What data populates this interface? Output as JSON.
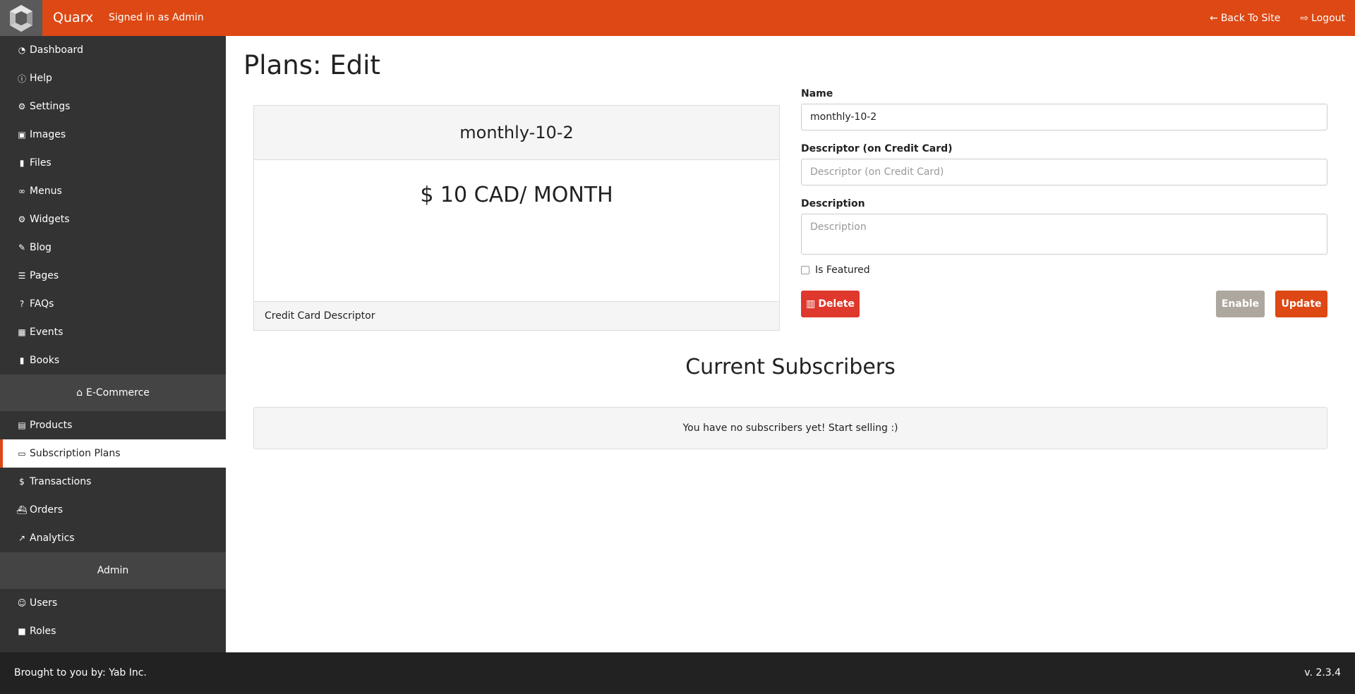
{
  "topbar": {
    "brand": "Quarx",
    "signed_in": "Signed in as Admin",
    "back_to_site": "Back To Site",
    "logout": "Logout",
    "accent_color": "#dd4814"
  },
  "sidebar": {
    "items": [
      {
        "label": "Dashboard",
        "icon": "dashboard-icon"
      },
      {
        "label": "Help",
        "icon": "info-icon"
      },
      {
        "label": "Settings",
        "icon": "gear-icon"
      },
      {
        "label": "Images",
        "icon": "image-icon"
      },
      {
        "label": "Files",
        "icon": "file-icon"
      },
      {
        "label": "Menus",
        "icon": "link-icon"
      },
      {
        "label": "Widgets",
        "icon": "gear-icon"
      },
      {
        "label": "Blog",
        "icon": "pencil-icon"
      },
      {
        "label": "Pages",
        "icon": "page-icon"
      },
      {
        "label": "FAQs",
        "icon": "question-icon"
      },
      {
        "label": "Events",
        "icon": "calendar-icon"
      },
      {
        "label": "Books",
        "icon": "file-icon"
      }
    ],
    "ecommerce_header": "E-Commerce",
    "ecommerce_items": [
      {
        "label": "Products",
        "icon": "box-icon"
      },
      {
        "label": "Subscription Plans",
        "icon": "credit-card-icon",
        "active": true
      },
      {
        "label": "Transactions",
        "icon": "dollar-icon"
      },
      {
        "label": "Orders",
        "icon": "ship-icon"
      },
      {
        "label": "Analytics",
        "icon": "chart-icon"
      }
    ],
    "admin_header": "Admin",
    "admin_items": [
      {
        "label": "Users",
        "icon": "users-icon"
      },
      {
        "label": "Roles",
        "icon": "lock-icon"
      }
    ]
  },
  "main": {
    "title": "Plans: Edit",
    "plan_card": {
      "name": "monthly-10-2",
      "price": "$ 10 CAD/ MONTH",
      "footer": "Credit Card Descriptor"
    },
    "form": {
      "name_label": "Name",
      "name_value": "monthly-10-2",
      "descriptor_label": "Descriptor (on Credit Card)",
      "descriptor_placeholder": "Descriptor (on Credit Card)",
      "description_label": "Description",
      "description_placeholder": "Description",
      "is_featured_label": "Is Featured",
      "is_featured": false,
      "delete_label": "Delete",
      "enable_label": "Enable",
      "update_label": "Update"
    },
    "subscribers_title": "Current Subscribers",
    "subscribers_empty": "You have no subscribers yet! Start selling :)"
  },
  "footer": {
    "credit": "Brought to you by: Yab Inc.",
    "version": "v. 2.3.4"
  }
}
